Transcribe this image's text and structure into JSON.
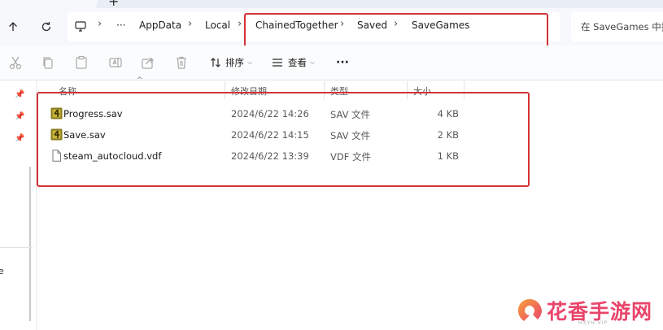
{
  "tab": {
    "new_tab_symbol": "+"
  },
  "navigation": {
    "breadcrumbs": [
      "AppData",
      "Local",
      "ChainedTogether",
      "Saved",
      "SaveGames"
    ],
    "overflow": "···",
    "search_placeholder": "在 SaveGames 中搜"
  },
  "toolbar": {
    "sort_label": "排序",
    "view_label": "查看",
    "more_label": "···"
  },
  "columns": {
    "name": "名称",
    "date": "修改日期",
    "type": "类型",
    "size": "大小"
  },
  "files": [
    {
      "name": "Progress.sav",
      "date": "2024/6/22 14:26",
      "type": "SAV 文件",
      "size": "4 KB",
      "icon": "sav-file-icon"
    },
    {
      "name": "Save.sav",
      "date": "2024/6/22 14:15",
      "type": "SAV 文件",
      "size": "2 KB",
      "icon": "sav-file-icon"
    },
    {
      "name": "steam_autocloud.vdf",
      "date": "2024/6/22 13:39",
      "type": "VDF 文件",
      "size": "1 KB",
      "icon": "generic-file-icon"
    }
  ],
  "sidebar": {
    "partial_label": "e"
  },
  "colors": {
    "highlight": "#d13438",
    "watermark": "#e9446a",
    "sav_icon": "#8a7a1e"
  },
  "watermark": {
    "text": "花香手游网",
    "url": "HXYH.VIP"
  }
}
